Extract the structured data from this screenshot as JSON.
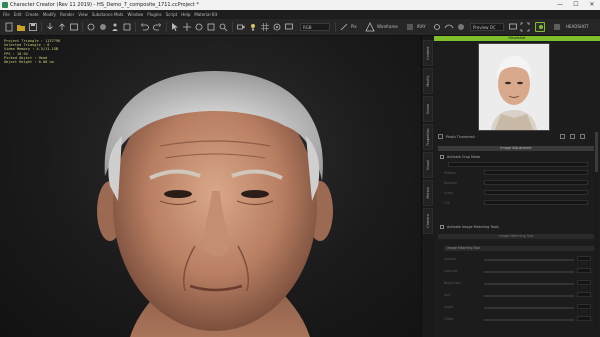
{
  "window": {
    "title": "Character Creator (Rev 11 2019) - HS_Demo_7_composite_1711.ccProject *",
    "minimize_label": "—",
    "maximize_label": "☐",
    "close_label": "✕"
  },
  "menu": [
    "File",
    "Edit",
    "Create",
    "Modify",
    "Render",
    "View",
    "Substance Mats",
    "Window",
    "Plugins",
    "Script",
    "Help",
    "Material Kit"
  ],
  "toolbar": {
    "render_dropdown": "RGB",
    "pick_label": "Pix",
    "wireframe_label": "Wireframe",
    "quality_label": "IRAY",
    "display_dropdown": "Preview DC",
    "headshot_label": "HEADSHOT",
    "icons": [
      "new-icon",
      "open-icon",
      "save-icon",
      "undo-icon",
      "redo-icon",
      "select-icon",
      "move-icon",
      "rotate-icon",
      "scale-icon",
      "camera-icon",
      "lighting-icon",
      "grid-icon",
      "render-icon",
      "headshot-icon"
    ]
  },
  "viewport": {
    "stats": [
      "Project Triangle : 1137796",
      "Selected Triangle : 0",
      "Video Memory : 4.5/11.1GB",
      "FPS : 10.94",
      "Picked Object : Head",
      "Object Height : 0.00 cm"
    ]
  },
  "side_tabs": [
    "Content",
    "Modify",
    "Scene",
    "Properties",
    "Visual",
    "Motion",
    "Camera"
  ],
  "panel": {
    "header": "Headshot",
    "photo_label": "Photo Thumbnail",
    "image_adjustment": "Image Adjustment",
    "activate_crop": "Activate Crop Mode",
    "dim_rows": [
      "Position",
      "Rotation",
      "Scale",
      "Flip"
    ],
    "activate_matching": "Activate Image Matching Tools",
    "matching_tools_bar": "Image Matching Tool",
    "image_matching_sub": "Image Matching Tool",
    "matching_fields": [
      "Opacity",
      "Contrast",
      "Brightness",
      "Size",
      "Angle",
      "Offset"
    ]
  },
  "colors": {
    "accent": "#7fbf2a",
    "stats_text": "#d6d07a"
  }
}
